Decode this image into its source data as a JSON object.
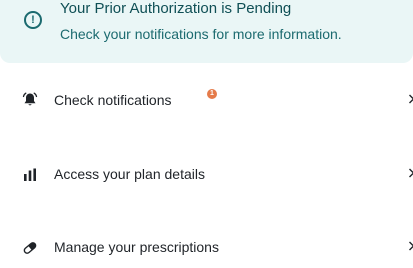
{
  "banner": {
    "icon": "alert-circle-icon",
    "title": "Your Prior Authorization is Pending",
    "subtitle": "Check your notifications for more information."
  },
  "menu": {
    "items": [
      {
        "icon": "bell-icon",
        "label": "Check notifications",
        "badge_count": "1"
      },
      {
        "icon": "bar-chart-icon",
        "label": "Access your plan details"
      },
      {
        "icon": "pill-icon",
        "label": "Manage your prescriptions"
      }
    ]
  },
  "colors": {
    "banner_bg": "#eaf6f6",
    "banner_text": "#0f4f55",
    "badge": "#e57b4a",
    "text": "#1f2328"
  }
}
